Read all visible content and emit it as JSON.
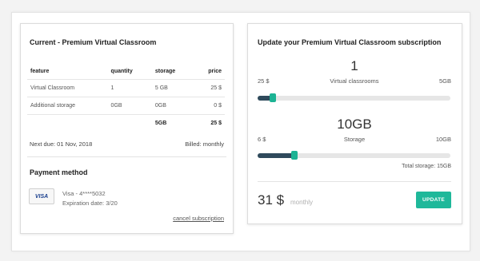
{
  "current": {
    "title": "Current - Premium Virtual Classroom",
    "headers": [
      "feature",
      "quantity",
      "storage",
      "price"
    ],
    "rows": [
      [
        "Virtual Classroom",
        "1",
        "5 GB",
        "25 $"
      ],
      [
        "Additional storage",
        "0GB",
        "0GB",
        "0 $"
      ]
    ],
    "total": {
      "storage": "5GB",
      "price": "25 $"
    },
    "next_due": "Next due: 01 Nov, 2018",
    "billed": "Billed: monthly"
  },
  "payment": {
    "title": "Payment method",
    "card_brand": "VISA",
    "card_number": "Visa - 4****5032",
    "expiration": "Expiration date: 3/20",
    "cancel_link": "cancel subscription"
  },
  "update": {
    "title": "Update your Premium Virtual Classroom subscription",
    "classrooms": {
      "value": "1",
      "label": "Virtual classrooms",
      "min": "25 $",
      "max": "5GB",
      "slider_fraction": 0.08
    },
    "storage": {
      "value": "10GB",
      "label": "Storage",
      "min": "6 $",
      "max": "10GB",
      "slider_fraction": 0.19
    },
    "total_storage": "Total storage: 15GB",
    "price": "31 $",
    "period": "monthly",
    "button": "UPDATE"
  },
  "colors": {
    "accent": "#1fb89a",
    "slider_fill": "#2f4a5c",
    "knob": "#1cb394"
  }
}
